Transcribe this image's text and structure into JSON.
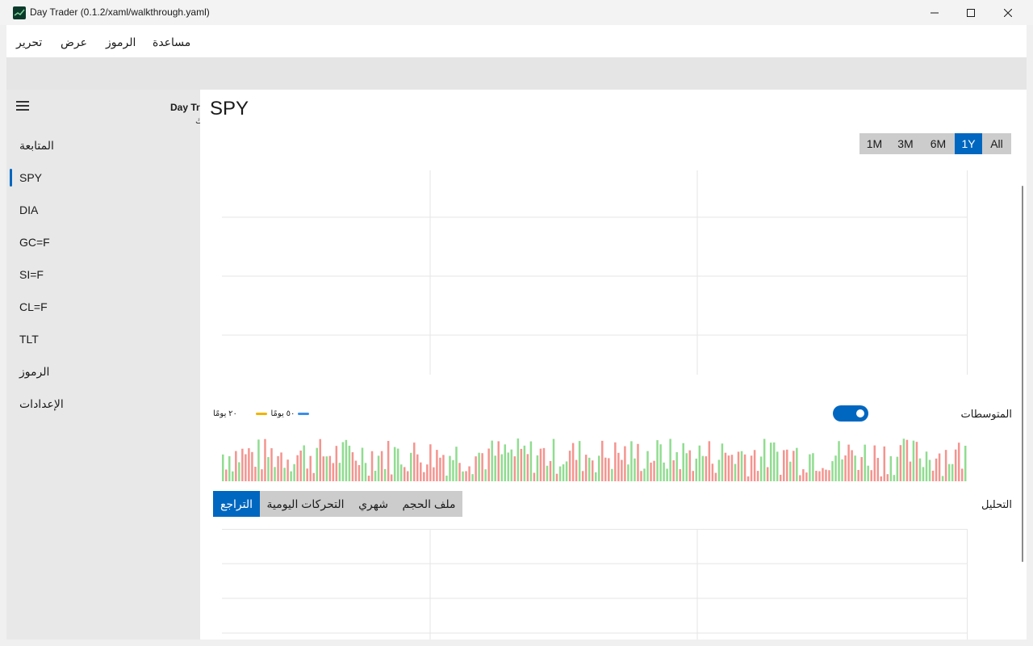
{
  "window": {
    "title": "Day Trader (0.1.2/xaml/walkthrough.yaml)",
    "icon": "stock-chart-icon"
  },
  "menu": {
    "items": [
      {
        "label": "تحرير"
      },
      {
        "label": "عرض"
      },
      {
        "label": "الرموز"
      },
      {
        "label": "مساعدة"
      }
    ]
  },
  "sidebar": {
    "brand": "Day Tr",
    "brand_sub": "ك",
    "items": [
      {
        "label": "المتابعة"
      },
      {
        "label": "SPY",
        "selected": true
      },
      {
        "label": "DIA"
      },
      {
        "label": "GC=F"
      },
      {
        "label": "SI=F"
      },
      {
        "label": "CL=F"
      },
      {
        "label": "TLT"
      },
      {
        "label": "الرموز"
      },
      {
        "label": "الإعدادات"
      }
    ]
  },
  "main": {
    "title": "SPY",
    "ranges": [
      "1M",
      "3M",
      "6M",
      "1Y",
      "All"
    ],
    "active_range": "1Y",
    "averages": {
      "label": "المتوسطات",
      "enabled": true,
      "legend": [
        {
          "label": "٥٠ يومًا",
          "color": "#f0b400"
        },
        {
          "label": "٢٠ يومًا",
          "color": "#3b8eea"
        }
      ]
    },
    "analysis": {
      "label": "التحليل",
      "tabs": [
        "التراجع",
        "التحركات اليومية",
        "شهري",
        "ملف الحجم"
      ],
      "active_tab": "التراجع"
    }
  },
  "colors": {
    "accent": "#0067c0",
    "volume_up": "#90dc90",
    "volume_down": "#f4948f"
  }
}
